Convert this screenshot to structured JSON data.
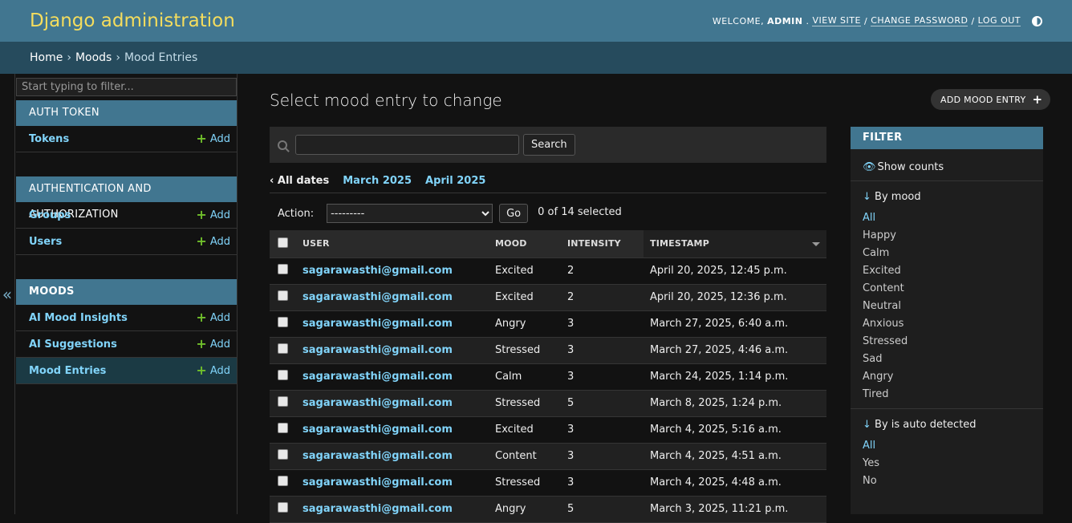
{
  "header": {
    "branding": "Django administration",
    "welcome": "WELCOME,",
    "username": "ADMIN",
    "view_site": "VIEW SITE",
    "change_password": "CHANGE PASSWORD",
    "log_out": "LOG OUT",
    "separator": "/"
  },
  "breadcrumbs": {
    "home": "Home",
    "app": "Moods",
    "current": "Mood Entries",
    "sep": "›"
  },
  "sidebar": {
    "filter_placeholder": "Start typing to filter...",
    "toggle_glyph": "«",
    "add_label": "Add",
    "modules": [
      {
        "caption": "AUTH TOKEN",
        "models": [
          "Tokens"
        ]
      },
      {
        "caption": "AUTHENTICATION AND AUTHORIZATION",
        "models": [
          "Groups",
          "Users"
        ]
      },
      {
        "caption": "MOODS",
        "models": [
          "AI Mood Insights",
          "AI Suggestions",
          "Mood Entries"
        ]
      }
    ]
  },
  "content": {
    "title": "Select mood entry to change",
    "add_button": "ADD MOOD ENTRY",
    "search_button": "Search",
    "search_value": "",
    "date_hierarchy": {
      "back": "‹ All dates",
      "links": [
        "March 2025",
        "April 2025"
      ]
    },
    "actions": {
      "label": "Action:",
      "selected_option": "---------",
      "go": "Go",
      "count": "0 of 14 selected"
    }
  },
  "table": {
    "columns": [
      "USER",
      "MOOD",
      "INTENSITY",
      "TIMESTAMP"
    ],
    "rows": [
      {
        "user": "sagarawasthi@gmail.com",
        "mood": "Excited",
        "intensity": "2",
        "timestamp": "April 20, 2025, 12:45 p.m."
      },
      {
        "user": "sagarawasthi@gmail.com",
        "mood": "Excited",
        "intensity": "2",
        "timestamp": "April 20, 2025, 12:36 p.m."
      },
      {
        "user": "sagarawasthi@gmail.com",
        "mood": "Angry",
        "intensity": "3",
        "timestamp": "March 27, 2025, 6:40 a.m."
      },
      {
        "user": "sagarawasthi@gmail.com",
        "mood": "Stressed",
        "intensity": "3",
        "timestamp": "March 27, 2025, 4:46 a.m."
      },
      {
        "user": "sagarawasthi@gmail.com",
        "mood": "Calm",
        "intensity": "3",
        "timestamp": "March 24, 2025, 1:14 p.m."
      },
      {
        "user": "sagarawasthi@gmail.com",
        "mood": "Stressed",
        "intensity": "5",
        "timestamp": "March 8, 2025, 1:24 p.m."
      },
      {
        "user": "sagarawasthi@gmail.com",
        "mood": "Excited",
        "intensity": "3",
        "timestamp": "March 4, 2025, 5:16 a.m."
      },
      {
        "user": "sagarawasthi@gmail.com",
        "mood": "Content",
        "intensity": "3",
        "timestamp": "March 4, 2025, 4:51 a.m."
      },
      {
        "user": "sagarawasthi@gmail.com",
        "mood": "Stressed",
        "intensity": "3",
        "timestamp": "March 4, 2025, 4:48 a.m."
      },
      {
        "user": "sagarawasthi@gmail.com",
        "mood": "Angry",
        "intensity": "5",
        "timestamp": "March 3, 2025, 11:21 p.m."
      }
    ]
  },
  "filter": {
    "title": "FILTER",
    "show_counts": "Show counts",
    "by_mood": {
      "heading": "By mood",
      "options": [
        "All",
        "Happy",
        "Calm",
        "Excited",
        "Content",
        "Neutral",
        "Anxious",
        "Stressed",
        "Sad",
        "Angry",
        "Tired"
      ]
    },
    "by_auto": {
      "heading": "By is auto detected",
      "options": [
        "All",
        "Yes",
        "No"
      ]
    }
  },
  "colors": {
    "header": "#417690",
    "breadcrumbs": "#264b5d",
    "branding": "#f5dd5d",
    "link": "#81d4fa",
    "add_plus": "#70bf2b",
    "background": "#121212"
  }
}
